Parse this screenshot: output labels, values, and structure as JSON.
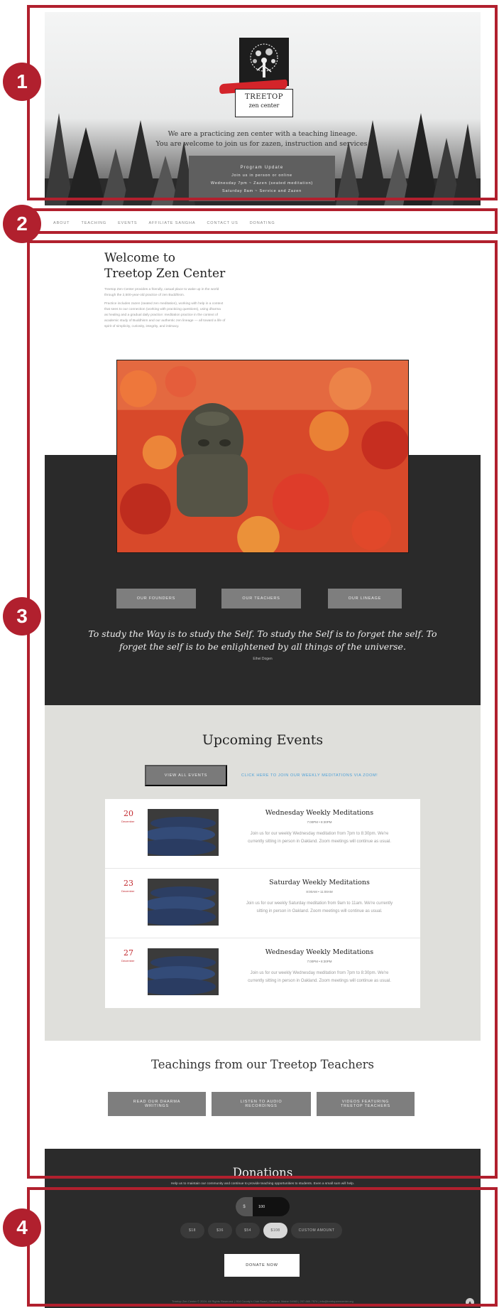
{
  "annotations": {
    "labels": [
      "1",
      "2",
      "3",
      "4"
    ]
  },
  "hero": {
    "logo_text_line1": "TREETOP",
    "logo_text_line2": "zen center",
    "intro_line1": "We are a practicing zen center with a teaching lineage.",
    "intro_line2": "You are welcome to join us for zazen, instruction and services.",
    "program": {
      "title": "Program Update",
      "line1": "Join us in person or online",
      "line2": "Wednesday 7pm ~ Zazen (seated meditation)",
      "line3": "Saturday 8am ~ Service and Zazen"
    }
  },
  "nav": {
    "items": [
      "ABOUT",
      "TEACHING",
      "EVENTS",
      "AFFILIATE SANGHA",
      "CONTACT US",
      "DONATING"
    ]
  },
  "welcome": {
    "title_line1": "Welcome to",
    "title_line2": "Treetop Zen Center",
    "para1_line1": "Treetop Zen Center provides a friendly, casual place to wake up in the world",
    "para1_line2": "through the 2,500-year-old practice of zen Buddhism.",
    "para2_line1": "Practice includes zazen (seated zen meditation), working with help in a context",
    "para2_line2": "that sees to our connection (working with practicing questions), using dharma",
    "para2_line3": "as healing and a gradual daily practice: meditation practice in the context of",
    "para2_line4": "academic study of Buddhism and our authentic zen lineage — all toward a life of",
    "para2_line5": "spirit of simplicity, curiosity, integrity, and intimacy."
  },
  "founders": {
    "buttons": [
      "OUR FOUNDERS",
      "OUR TEACHERS",
      "OUR LINEAGE"
    ],
    "quote_line1": "To study the Way is to study the Self. To study the Self is to forget the self. To",
    "quote_line2": "forget the self is to be enlightened by all things of the universe.",
    "quote_author": "Eihei Dogen"
  },
  "events": {
    "title": "Upcoming Events",
    "view_all": "VIEW ALL EVENTS",
    "zoom_link": "CLICK HERE TO JOIN OUR WEEKLY MEDITATIONS VIA ZOOM!",
    "items": [
      {
        "day": "20",
        "month": "December",
        "title": "Wednesday Weekly Meditations",
        "time": "7:00PM • 8:30PM",
        "desc_line1": "Join us for our weekly Wednesday meditation from 7pm to 8:30pm. We're",
        "desc_line2": "currently sitting in person in Oakland. Zoom meetings will continue as usual."
      },
      {
        "day": "23",
        "month": "December",
        "title": "Saturday Weekly Meditations",
        "time": "8:00AM • 11:00AM",
        "desc_line1": "Join us for our weekly Saturday meditation from 9am to 11am. We're currently",
        "desc_line2": "sitting in person in Oakland. Zoom meetings will continue as usual."
      },
      {
        "day": "27",
        "month": "December",
        "title": "Wednesday Weekly Meditations",
        "time": "7:00PM • 8:30PM",
        "desc_line1": "Join us for our weekly Wednesday meditation from 7pm to 8:30pm. We're",
        "desc_line2": "currently sitting in person in Oakland. Zoom meetings will continue as usual."
      }
    ]
  },
  "teachings": {
    "title": "Teachings from our Treetop Teachers",
    "buttons": [
      {
        "line1": "READ OUR DHARMA",
        "line2": "WRITINGS"
      },
      {
        "line1": "LISTEN TO AUDIO",
        "line2": "RECORDINGS"
      },
      {
        "line1": "VIDEOS FEATURING",
        "line2": "TREETOP TEACHERS"
      }
    ]
  },
  "donations": {
    "title": "Donations",
    "subtitle": "Help us to maintain our community and continue to provide teaching opportunities to students. Even a small sum will help.",
    "currency_symbol": "$",
    "amount_value": "100",
    "presets": [
      "$18",
      "$36",
      "$54",
      "$108",
      "CUSTOM AMOUNT"
    ],
    "donate_button": "DONATE NOW"
  },
  "footer": {
    "text": "Treetop Zen Center © 2024. All Rights Reserved. | 914 County's Club Road | Oakland, Maine 04963 | 207-660-7574 | info@treetopzencenter.org",
    "scroll_top_icon": "▲"
  },
  "colors": {
    "annotation": "#b1202e",
    "dark_band": "#2a2a2a",
    "events_band": "#dfdfdb",
    "event_date": "#c2282e",
    "zoom_link": "#4a9fd8"
  }
}
